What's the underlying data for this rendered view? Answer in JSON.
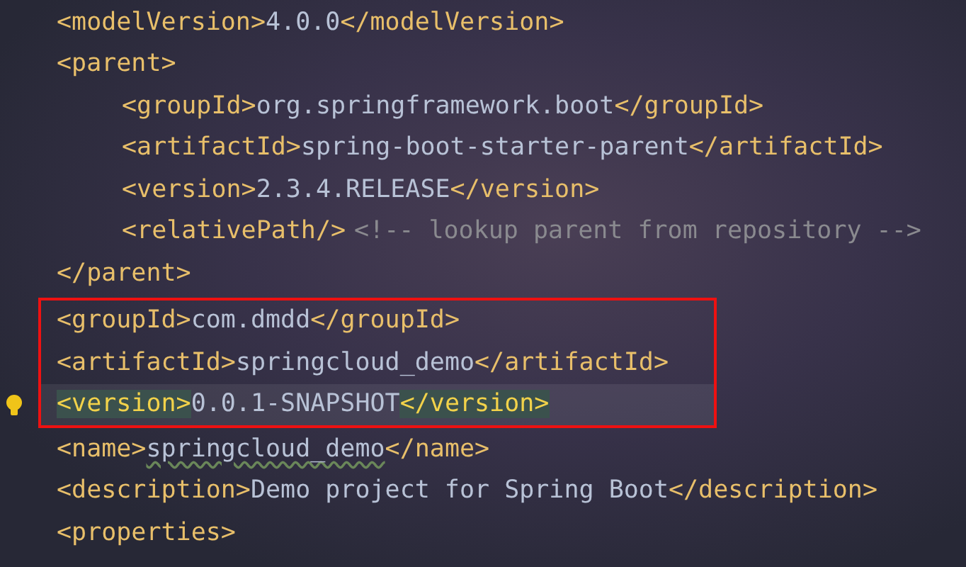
{
  "editor": {
    "lines": [
      {
        "kind": "line",
        "segments": [
          {
            "kind": "tag",
            "text": "<modelVersion>"
          },
          {
            "kind": "text",
            "text": "4.0.0"
          },
          {
            "kind": "tag",
            "text": "</modelVersion>"
          }
        ]
      },
      {
        "kind": "line",
        "segments": [
          {
            "kind": "tag",
            "text": "<parent>"
          }
        ],
        "children": [
          {
            "kind": "line",
            "segments": [
              {
                "kind": "tag",
                "text": "<groupId>"
              },
              {
                "kind": "text",
                "text": "org.springframework.boot"
              },
              {
                "kind": "tag",
                "text": "</groupId>"
              }
            ]
          },
          {
            "kind": "line",
            "segments": [
              {
                "kind": "tag",
                "text": "<artifactId>"
              },
              {
                "kind": "text",
                "text": "spring-boot-starter-parent"
              },
              {
                "kind": "tag",
                "text": "</artifactId>"
              }
            ]
          },
          {
            "kind": "line",
            "segments": [
              {
                "kind": "tag",
                "text": "<version>"
              },
              {
                "kind": "text",
                "text": "2.3.4.RELEASE"
              },
              {
                "kind": "tag",
                "text": "</version>"
              }
            ]
          },
          {
            "kind": "line",
            "segments": [
              {
                "kind": "tag",
                "text": "<relativePath/>"
              },
              {
                "kind": "comment",
                "text": "<!-- lookup parent from repository -->"
              }
            ]
          }
        ]
      },
      {
        "kind": "line",
        "segments": [
          {
            "kind": "tag",
            "text": "</parent>"
          }
        ]
      },
      {
        "kind": "boxed_group",
        "lines": [
          {
            "kind": "line",
            "segments": [
              {
                "kind": "tag",
                "text": "<groupId>"
              },
              {
                "kind": "text",
                "text": "com.dmdd"
              },
              {
                "kind": "tag",
                "text": "</groupId>"
              }
            ]
          },
          {
            "kind": "line",
            "segments": [
              {
                "kind": "tag",
                "text": "<artifactId>"
              },
              {
                "kind": "text",
                "text": "springcloud_demo"
              },
              {
                "kind": "tag",
                "text": "</artifactId>"
              }
            ]
          },
          {
            "kind": "line",
            "current": true,
            "segments": [
              {
                "kind": "tag",
                "text": "<version>",
                "matched": true
              },
              {
                "kind": "text",
                "text": "0.0.1-SNAPSHOT"
              },
              {
                "kind": "tag",
                "text": "</version>",
                "matched": true
              }
            ]
          }
        ]
      },
      {
        "kind": "line",
        "segments": [
          {
            "kind": "tag",
            "text": "<name>"
          },
          {
            "kind": "text",
            "text": "springcloud_demo",
            "typo": true
          },
          {
            "kind": "tag",
            "text": "</name>"
          }
        ]
      },
      {
        "kind": "line",
        "segments": [
          {
            "kind": "tag",
            "text": "<description>"
          },
          {
            "kind": "text",
            "text": "Demo project for Spring Boot"
          },
          {
            "kind": "tag",
            "text": "</description>"
          }
        ]
      },
      {
        "kind": "line",
        "segments": [
          {
            "kind": "tag",
            "text": "<properties>"
          }
        ]
      }
    ]
  }
}
